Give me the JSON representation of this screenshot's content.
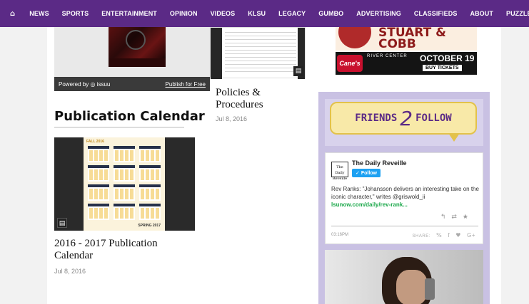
{
  "nav": {
    "home_icon": "home-icon",
    "items": [
      "NEWS",
      "SPORTS",
      "ENTERTAINMENT",
      "OPINION",
      "VIDEOS",
      "KLSU",
      "LEGACY",
      "GUMBO",
      "ADVERTISING",
      "CLASSIFIEDS",
      "ABOUT",
      "PUZZLES"
    ]
  },
  "issuu": {
    "powered_prefix": "Powered by",
    "brand": "issuu",
    "publish": "Publish for Free"
  },
  "policies": {
    "title": "Policies & Procedures",
    "date": "Jul 8, 2016"
  },
  "publication_calendar": {
    "heading": "Publication Calendar",
    "thumb_top": "FALL 2016",
    "thumb_bottom": "SPRING 2017",
    "title": "2016 - 2017 Publication Calendar",
    "date": "Jul 8, 2016"
  },
  "ads": {
    "top_names": "STUART & COBB",
    "canes": "Cane's",
    "venue": "RIVER CENTER",
    "date": "OCTOBER 19",
    "cta": "BUY TICKETS"
  },
  "friends_follow": {
    "left": "FRIENDS",
    "number": "2",
    "right": "FOLLOW"
  },
  "tweet": {
    "logo": "The Daily Reveille",
    "account": "The Daily Reveille",
    "follow": "Follow",
    "text": "Rev Ranks: \"Johansson delivers an interesting take on the iconic character,\" writes @griswold_ii",
    "link": "lsunow.com/daily/rev-rank...",
    "time": "03:16PM",
    "share_label": "SHARE:"
  },
  "colors": {
    "nav_bg": "#5b2a86",
    "sidebar_bg": "#c9c1e3",
    "twitter_blue": "#1da1f2",
    "link_green": "#1ba84a"
  }
}
